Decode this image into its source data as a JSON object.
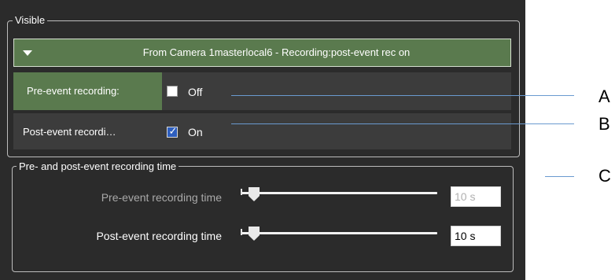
{
  "visible_group": {
    "legend": "Visible",
    "dropdown_title": "From Camera 1masterlocal6 - Recording:post-event rec on",
    "rows": [
      {
        "label": "Pre-event recording:",
        "checked": false,
        "state": "Off"
      },
      {
        "label": "Post-event recordi…",
        "checked": true,
        "state": "On"
      }
    ]
  },
  "timing_group": {
    "legend": "Pre- and post-event recording time",
    "sliders": [
      {
        "label": "Pre-event recording time",
        "value_text": "10 s",
        "enabled": false
      },
      {
        "label": "Post-event recording time",
        "value_text": "10 s",
        "enabled": true
      }
    ]
  },
  "callouts": [
    "A",
    "B",
    "C"
  ],
  "colors": {
    "panel_bg": "#2b2b2b",
    "header_green": "#5a7a4e",
    "row_bg": "#3c3c3c",
    "checkbox_checked": "#2e5fbf",
    "callout_line": "#6a9ad0"
  }
}
